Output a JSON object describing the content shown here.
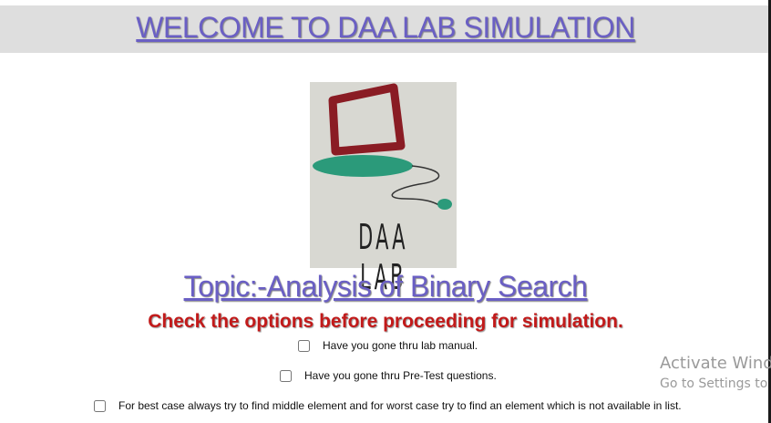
{
  "header": {
    "title": "WELCOME TO DAA LAB SIMULATION"
  },
  "logo": {
    "text": "DAA LAB",
    "colors": {
      "monitor": "#8a1c24",
      "base": "#2b9a7a",
      "background": "#d8d8d2"
    }
  },
  "topic": "Topic:-Analysis of Binary Search",
  "instruction": "Check the options before proceeding for simulation.",
  "checklist": [
    {
      "label": "Have you gone thru lab manual.",
      "checked": false
    },
    {
      "label": "Have you gone thru Pre-Test questions.",
      "checked": false
    },
    {
      "label": "For best case always try to find middle element and for worst case try to find an element which is not available in list.",
      "checked": false
    }
  ],
  "watermark": {
    "line1": "Activate Wind",
    "line2": "Go to Settings to a"
  }
}
